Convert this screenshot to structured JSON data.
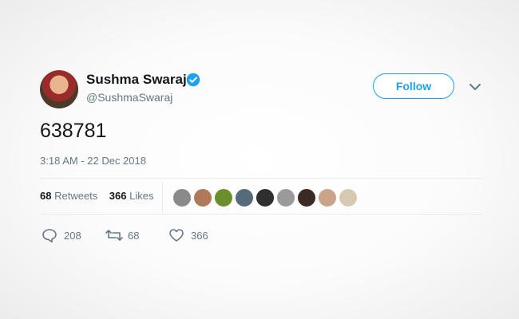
{
  "tweet": {
    "author_name": "Sushma Swaraj",
    "author_handle": "@SushmaSwaraj",
    "follow_label": "Follow",
    "text": "638781",
    "timestamp": "3:18 AM - 22 Dec 2018",
    "retweets_count": "68",
    "retweets_label": "Retweets",
    "likes_count": "366",
    "likes_label": "Likes",
    "reply_count": "208",
    "retweet_action_count": "68",
    "like_action_count": "366"
  },
  "colors": {
    "accent": "#1da1f2",
    "muted": "#657786",
    "text": "#14171a"
  }
}
